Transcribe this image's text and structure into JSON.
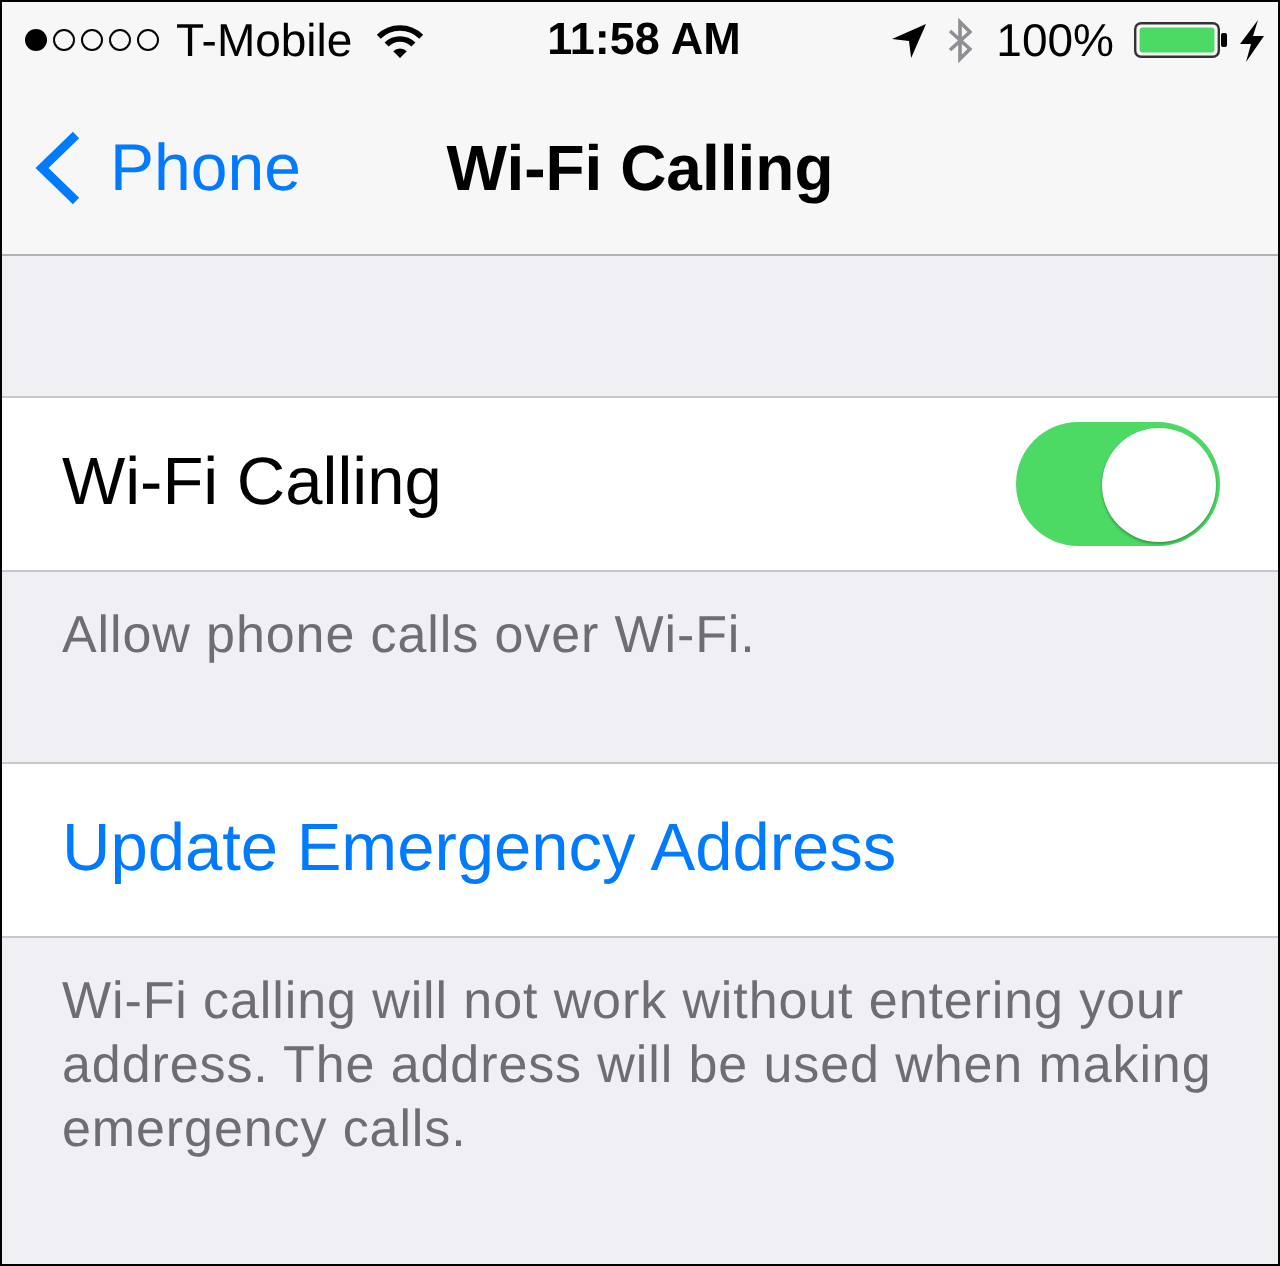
{
  "status_bar": {
    "carrier": "T-Mobile",
    "time": "11:58 AM",
    "battery": "100%",
    "charging": true
  },
  "nav_bar": {
    "back": "Phone",
    "title": "Wi-Fi Calling"
  },
  "sections": [
    {
      "rows": [
        {
          "kind": "toggle",
          "label": "Wi-Fi Calling",
          "on": true
        }
      ],
      "footer": "Allow phone calls over Wi-Fi."
    },
    {
      "rows": [
        {
          "kind": "action",
          "label": "Update Emergency Address"
        }
      ],
      "footer": "Wi-Fi calling will not work without entering your address. The address will be used when making emergency calls."
    }
  ]
}
